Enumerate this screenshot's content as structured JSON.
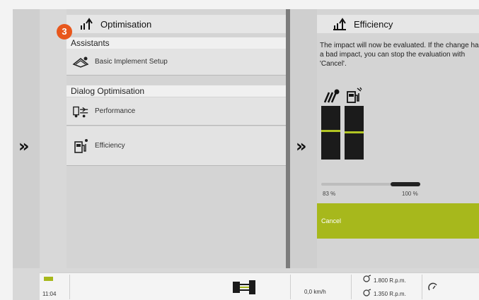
{
  "left_panel": {
    "title": "Optimisation",
    "badge": "3",
    "sections": [
      {
        "label": "Assistants",
        "items": [
          {
            "label": "Basic Implement Setup",
            "icon": "implement-icon"
          }
        ]
      },
      {
        "label": "Dialog Optimisation",
        "items": [
          {
            "label": "Performance",
            "icon": "performance-icon"
          },
          {
            "label": "Efficiency",
            "icon": "fuel-efficiency-icon"
          }
        ]
      }
    ]
  },
  "right_panel": {
    "title": "Efficiency",
    "text": "The impact will now be evaluated. If the change has a bad impact, you can stop the evaluation with 'Cancel'.",
    "progress": {
      "left_label": "83 %",
      "right_label": "100 %",
      "fill_fraction": 0.3
    },
    "cancel_label": "Cancel"
  },
  "status_bar": {
    "time": "11:04",
    "speed": "0,0 km/h",
    "rpm1": "1.800 R.p.m.",
    "rpm2": "1.350 R.p.m."
  },
  "colors": {
    "accent_green": "#a7b81c",
    "badge_orange": "#e8571c",
    "divider": "#7c7c7c"
  }
}
